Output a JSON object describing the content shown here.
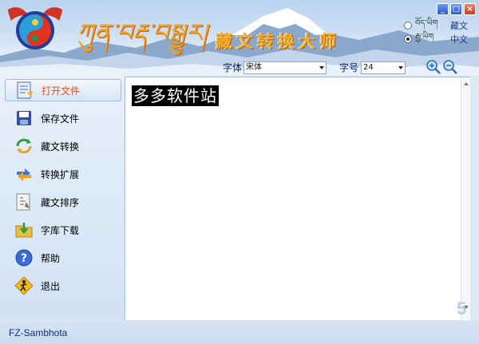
{
  "header": {
    "tibetan_title": "ཀུན་བརྡ་བསྒྱུར།",
    "chinese_title": "藏文转换大师",
    "window_buttons": [
      "_",
      "□",
      "×"
    ]
  },
  "language": {
    "options": [
      {
        "tibetan": "བོད་ཡིག",
        "label": "藏文",
        "selected": false
      },
      {
        "tibetan": "རྒྱ་ཡིག",
        "label": "中文",
        "selected": true
      }
    ]
  },
  "toolbar": {
    "font_label": "字体",
    "font_value": "宋体",
    "size_label": "字号",
    "size_value": "24",
    "zoom_in": "zoom-in-icon",
    "zoom_out": "zoom-out-icon"
  },
  "sidebar": {
    "items": [
      {
        "label": "打开文件",
        "icon": "open-file-icon",
        "active": true
      },
      {
        "label": "保存文件",
        "icon": "save-icon",
        "active": false
      },
      {
        "label": "藏文转换",
        "icon": "convert-icon",
        "active": false
      },
      {
        "label": "转换扩展",
        "icon": "extend-icon",
        "active": false
      },
      {
        "label": "藏文排序",
        "icon": "sort-icon",
        "active": false
      },
      {
        "label": "字库下载",
        "icon": "folder-download-icon",
        "active": false
      },
      {
        "label": "帮助",
        "icon": "help-icon",
        "active": false
      },
      {
        "label": "退出",
        "icon": "exit-icon",
        "active": false
      }
    ]
  },
  "editor": {
    "text": "多多软件站"
  },
  "watermark": "5",
  "status": {
    "text": "FZ-Sambhota"
  },
  "colors": {
    "accent_orange": "#e2531e",
    "title_gold": "#f5b030"
  }
}
